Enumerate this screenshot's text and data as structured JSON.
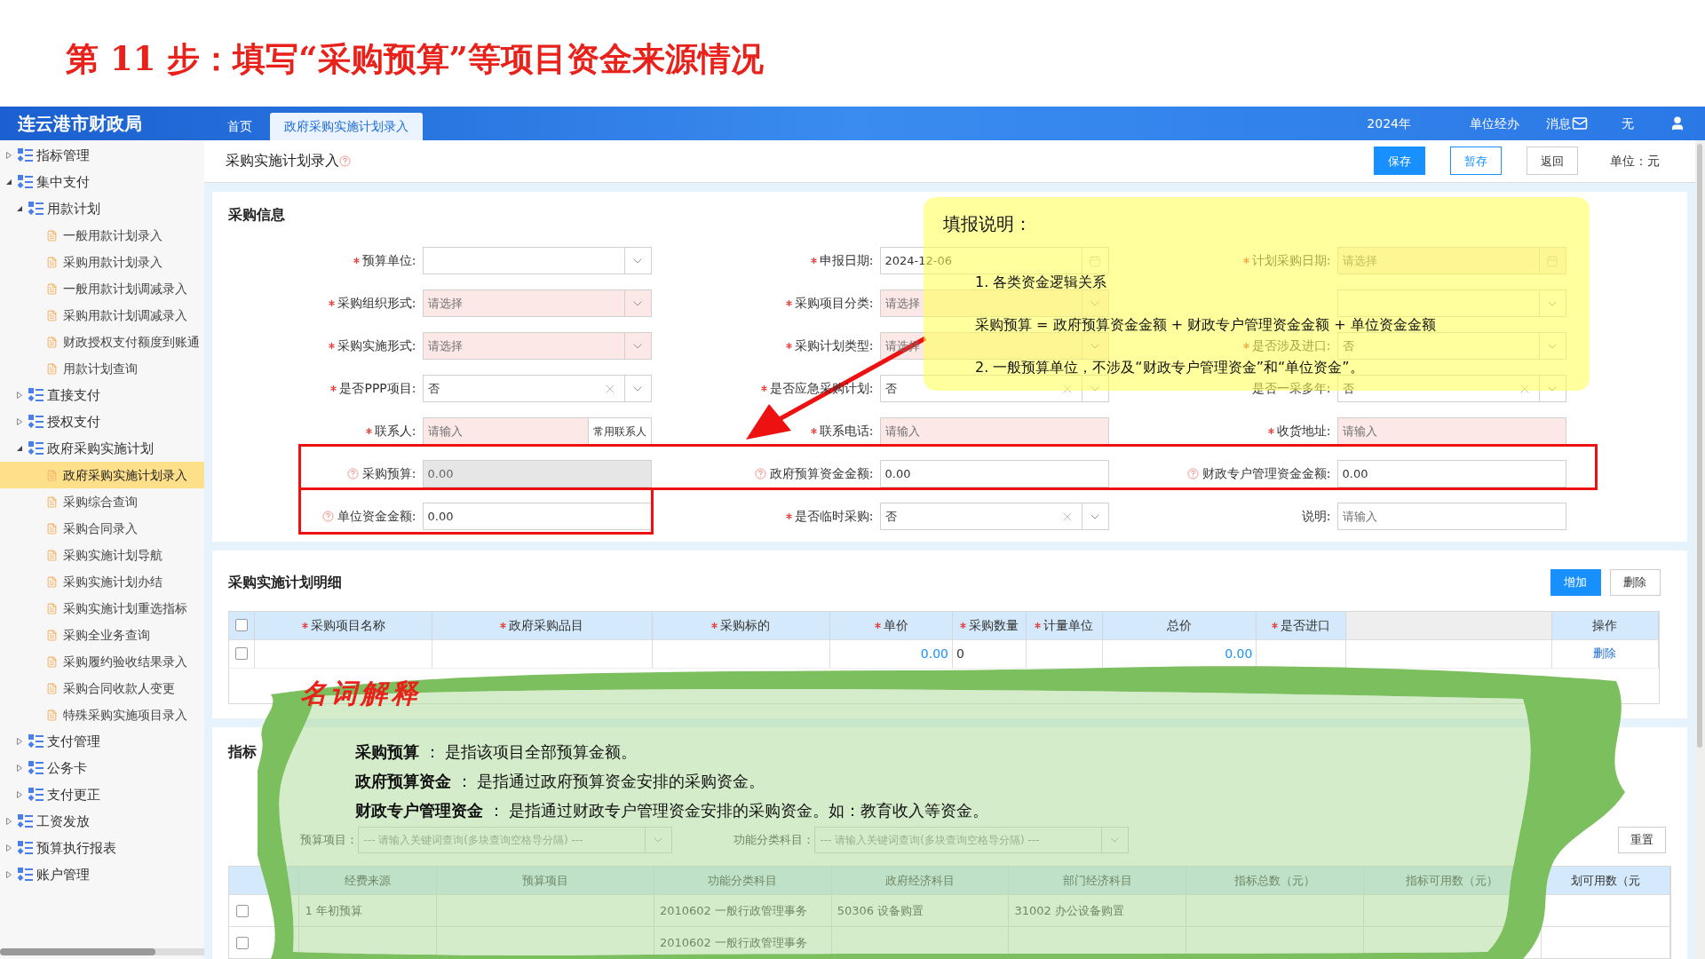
{
  "step_title": "第 11 步：填写“采购预算”等项目资金来源情况",
  "header": {
    "logo": "连云港市财政局",
    "tabs": [
      {
        "label": "首页",
        "selected": false
      },
      {
        "label": "政府采购实施计划录入",
        "selected": true
      }
    ],
    "year": "2024年",
    "role": "单位经办",
    "messages": "消息",
    "user": "无"
  },
  "sidebar": {
    "items": [
      {
        "kind": "group",
        "label": "指标管理",
        "expanded": false
      },
      {
        "kind": "group",
        "label": "集中支付",
        "expanded": true,
        "children": [
          {
            "kind": "group",
            "label": "用款计划",
            "expanded": true,
            "children": [
              {
                "kind": "leaf",
                "label": "一般用款计划录入",
                "selected": false
              },
              {
                "kind": "leaf",
                "label": "采购用款计划录入",
                "selected": false
              },
              {
                "kind": "leaf",
                "label": "一般用款计划调减录入",
                "selected": false
              },
              {
                "kind": "leaf",
                "label": "采购用款计划调减录入",
                "selected": false
              },
              {
                "kind": "leaf",
                "label": "财政授权支付额度到账通",
                "selected": false
              },
              {
                "kind": "leaf",
                "label": "用款计划查询",
                "selected": false
              }
            ]
          },
          {
            "kind": "group",
            "label": "直接支付",
            "expanded": false
          },
          {
            "kind": "group",
            "label": "授权支付",
            "expanded": false
          },
          {
            "kind": "group",
            "label": "政府采购实施计划",
            "expanded": true,
            "children": [
              {
                "kind": "leaf",
                "label": "政府采购实施计划录入",
                "selected": true
              },
              {
                "kind": "leaf",
                "label": "采购综合查询",
                "selected": false
              },
              {
                "kind": "leaf",
                "label": "采购合同录入",
                "selected": false
              },
              {
                "kind": "leaf",
                "label": "采购实施计划导航",
                "selected": false
              },
              {
                "kind": "leaf",
                "label": "采购实施计划办结",
                "selected": false
              },
              {
                "kind": "leaf",
                "label": "采购实施计划重选指标",
                "selected": false
              },
              {
                "kind": "leaf",
                "label": "采购全业务查询",
                "selected": false
              },
              {
                "kind": "leaf",
                "label": "采购履约验收结果录入",
                "selected": false
              },
              {
                "kind": "leaf",
                "label": "采购合同收款人变更",
                "selected": false
              },
              {
                "kind": "leaf",
                "label": "特殊采购实施项目录入",
                "selected": false
              }
            ]
          },
          {
            "kind": "group",
            "label": "支付管理",
            "expanded": false
          },
          {
            "kind": "group",
            "label": "公务卡",
            "expanded": false
          },
          {
            "kind": "group",
            "label": "支付更正",
            "expanded": false
          }
        ]
      },
      {
        "kind": "group",
        "label": "工资发放",
        "expanded": false
      },
      {
        "kind": "group",
        "label": "预算执行报表",
        "expanded": false
      },
      {
        "kind": "group",
        "label": "账户管理",
        "expanded": false
      }
    ]
  },
  "page": {
    "title": "采购实施计划录入",
    "buttons": [
      {
        "label": "保存",
        "kind": "primary"
      },
      {
        "label": "暂存",
        "kind": "outline"
      },
      {
        "label": "返回",
        "kind": "plain"
      }
    ],
    "unit": "单位：元"
  },
  "form": {
    "title": "采购信息",
    "fields": [
      {
        "label": "预算单位:",
        "kind": "select",
        "required": true,
        "help": false,
        "pink": false,
        "clearable": false,
        "readonly": false
      },
      {
        "label": "申报日期:",
        "kind": "date",
        "value": "2024-12-06",
        "required": true,
        "help": false,
        "pink": false,
        "clearable": false,
        "readonly": false
      },
      {
        "label": "计划采购日期:",
        "kind": "date",
        "placeholder": "请选择",
        "required": true,
        "help": false,
        "pink": true,
        "clearable": false,
        "readonly": false
      },
      {
        "label": "采购组织形式:",
        "kind": "select",
        "placeholder": "请选择",
        "required": true,
        "help": false,
        "pink": true,
        "clearable": false,
        "readonly": false
      },
      {
        "label": "采购项目分类:",
        "kind": "select",
        "placeholder": "请选择",
        "required": true,
        "help": false,
        "pink": true,
        "clearable": false,
        "readonly": false
      },
      {
        "kind": "select"
      },
      {
        "label": "采购实施形式:",
        "kind": "select",
        "placeholder": "请选择",
        "required": true,
        "help": false,
        "pink": true,
        "clearable": false,
        "readonly": false
      },
      {
        "label": "采购计划类型:",
        "kind": "select",
        "placeholder": "请选择",
        "required": true,
        "help": false,
        "pink": true,
        "clearable": false,
        "readonly": false
      },
      {
        "label": "是否涉及进口:",
        "kind": "select",
        "value": "否",
        "required": true,
        "help": false,
        "pink": false,
        "clearable": false,
        "readonly": false
      },
      {
        "label": "是否PPP项目:",
        "kind": "select",
        "value": "否",
        "required": true,
        "help": false,
        "pink": false,
        "clearable": true,
        "readonly": false
      },
      {
        "label": "是否应急采购计划:",
        "kind": "select",
        "value": "否",
        "required": true,
        "help": false,
        "pink": false,
        "clearable": true,
        "readonly": false
      },
      {
        "label": "是否一采多年:",
        "kind": "select",
        "value": "否",
        "required": false,
        "help": false,
        "pink": false,
        "clearable": true,
        "readonly": false
      },
      {
        "label": "联系人:",
        "kind": "input",
        "placeholder": "请输入",
        "button": "常用联系人",
        "required": true,
        "help": false,
        "pink": true,
        "clearable": false,
        "readonly": false
      },
      {
        "label": "联系电话:",
        "kind": "input",
        "placeholder": "请输入",
        "required": true,
        "help": false,
        "pink": true,
        "clearable": false,
        "readonly": false
      },
      {
        "label": "收货地址:",
        "kind": "input",
        "placeholder": "请输入",
        "required": true,
        "help": false,
        "pink": true,
        "clearable": false,
        "readonly": false
      },
      {
        "label": "采购预算:",
        "kind": "input",
        "value": "0.00",
        "required": false,
        "help": true,
        "pink": false,
        "clearable": false,
        "readonly": true
      },
      {
        "label": "政府预算资金金额:",
        "kind": "input",
        "value": "0.00",
        "required": false,
        "help": true,
        "pink": false,
        "clearable": false,
        "readonly": false
      },
      {
        "label": "财政专户管理资金金额:",
        "kind": "input",
        "value": "0.00",
        "required": false,
        "help": true,
        "pink": false,
        "clearable": false,
        "readonly": false
      },
      {
        "label": "单位资金金额:",
        "kind": "input",
        "value": "0.00",
        "required": false,
        "help": true,
        "pink": false,
        "clearable": false,
        "readonly": false
      },
      {
        "label": "是否临时采购:",
        "kind": "select",
        "value": "否",
        "required": true,
        "help": false,
        "pink": false,
        "clearable": true,
        "readonly": false
      },
      {
        "label": "说明:",
        "kind": "input",
        "placeholder": "请输入",
        "required": false,
        "help": false,
        "pink": false,
        "clearable": false,
        "readonly": false
      }
    ]
  },
  "notes": {
    "heading": "填报说明：",
    "lines": [
      "1. 各类资金逻辑关系",
      "采购预算 = 政府预算资金金额 + 财政专户管理资金金额 + 单位资金金额",
      "2. 一般预算单位，不涉及“财政专户管理资金”和“单位资金”。"
    ]
  },
  "detail": {
    "title": "采购实施计划明细",
    "buttons": [
      {
        "label": "增加",
        "kind": "primary"
      },
      {
        "label": "删除",
        "kind": "plain"
      }
    ],
    "all_checked": false,
    "columns": [
      {
        "label": "采购项目名称",
        "required": true
      },
      {
        "label": "政府采购品目",
        "required": true
      },
      {
        "label": "采购标的",
        "required": true
      },
      {
        "label": "单价",
        "required": true
      },
      {
        "label": "采购数量",
        "required": true
      },
      {
        "label": "计量单位",
        "required": true
      },
      {
        "label": "总价",
        "required": false
      },
      {
        "label": "是否进口",
        "required": true
      },
      {
        "label": "操作",
        "required": false
      }
    ],
    "rows": [
      {
        "checked": false,
        "cells": [
          "",
          "",
          "",
          "0.00",
          "0",
          "",
          "0.00",
          "",
          "删除"
        ]
      }
    ]
  },
  "glossary": {
    "heading": "名词解释",
    "entries": [
      "**采购预算** ： 是指该项目全部预算金额。",
      "**政府预算资金** ： 是指通过政府预算资金安排的采购资金。",
      "**财政专户管理资金** ： 是指通过财政专户管理资金安排的采购资金。如：教育收入等资金。"
    ]
  },
  "indicators": {
    "title": "指标",
    "filters": [
      {
        "label": "预算项目：",
        "placeholder": "--- 请输入关键词查询(多块查询空格导分隔) ---"
      },
      {
        "label": "功能分类科目：",
        "placeholder": "--- 请输入关键词查询(多块查询空格导分隔) ---"
      }
    ],
    "reset": "重置",
    "columns": [
      "经费来源",
      "预算项目",
      "功能分类科目",
      "政府经济科目",
      "部门经济科目",
      "指标总数（元）",
      "指标可用数（元）",
      "划可用数（元"
    ],
    "rows": [
      {
        "checked": false,
        "cells": [
          "1 年初预算",
          "",
          "2010602 一般行政管理事务",
          "50306 设备购置",
          "31002 办公设备购置",
          "",
          "",
          ""
        ]
      },
      {
        "checked": false,
        "cells": [
          "",
          "",
          "2010602 一般行政管理事务",
          "",
          "",
          "",
          "",
          ""
        ]
      }
    ]
  }
}
